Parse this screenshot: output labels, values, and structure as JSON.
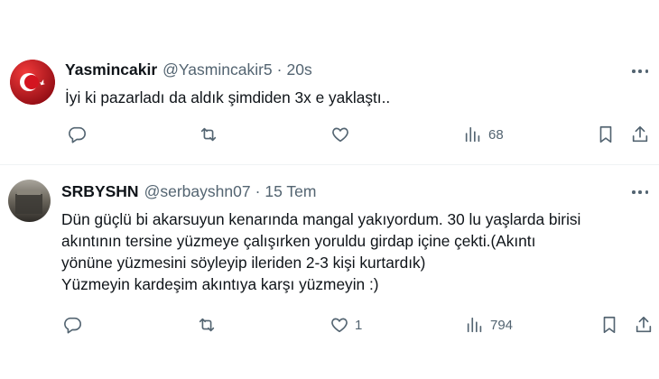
{
  "tweets": [
    {
      "name": "Yasmincakir",
      "handle": "@Yasmincakir5",
      "separator": "·",
      "time": "20s",
      "text_lines": [
        "İyi ki pazarladı da aldık şimdiden 3x e yaklaştı.."
      ],
      "reply_count": "",
      "retweet_count": "",
      "like_count": "",
      "view_count": "68",
      "avatar": "turkish-flag",
      "icons": {
        "more": "more-icon",
        "reply": "reply-icon",
        "retweet": "retweet-icon",
        "like": "heart-icon",
        "views": "views-icon",
        "bookmark": "bookmark-icon",
        "share": "share-icon"
      }
    },
    {
      "name": "SRBYSHN",
      "handle": "@serbayshn07",
      "separator": "·",
      "time": "15 Tem",
      "text_lines": [
        "Dün güçlü bi akarsuyun kenarında mangal yakıyordum. 30 lu yaşlarda birisi",
        "akıntının tersine yüzmeye çalışırken yoruldu girdap içine çekti.(Akıntı",
        "yönüne yüzmesini söyleyip ileriden 2-3 kişi kurtardık)",
        "Yüzmeyin kardeşim akıntıya karşı yüzmeyin :)"
      ],
      "reply_count": "",
      "retweet_count": "",
      "like_count": "1",
      "view_count": "794",
      "avatar": "profile-photo",
      "icons": {
        "more": "more-icon",
        "reply": "reply-icon",
        "retweet": "retweet-icon",
        "like": "heart-icon",
        "views": "views-icon",
        "bookmark": "bookmark-icon",
        "share": "share-icon"
      }
    }
  ],
  "colors": {
    "text_primary": "#0f1419",
    "text_secondary": "#536471",
    "divider": "#eff3f4",
    "flag_red": "#e30a17"
  }
}
